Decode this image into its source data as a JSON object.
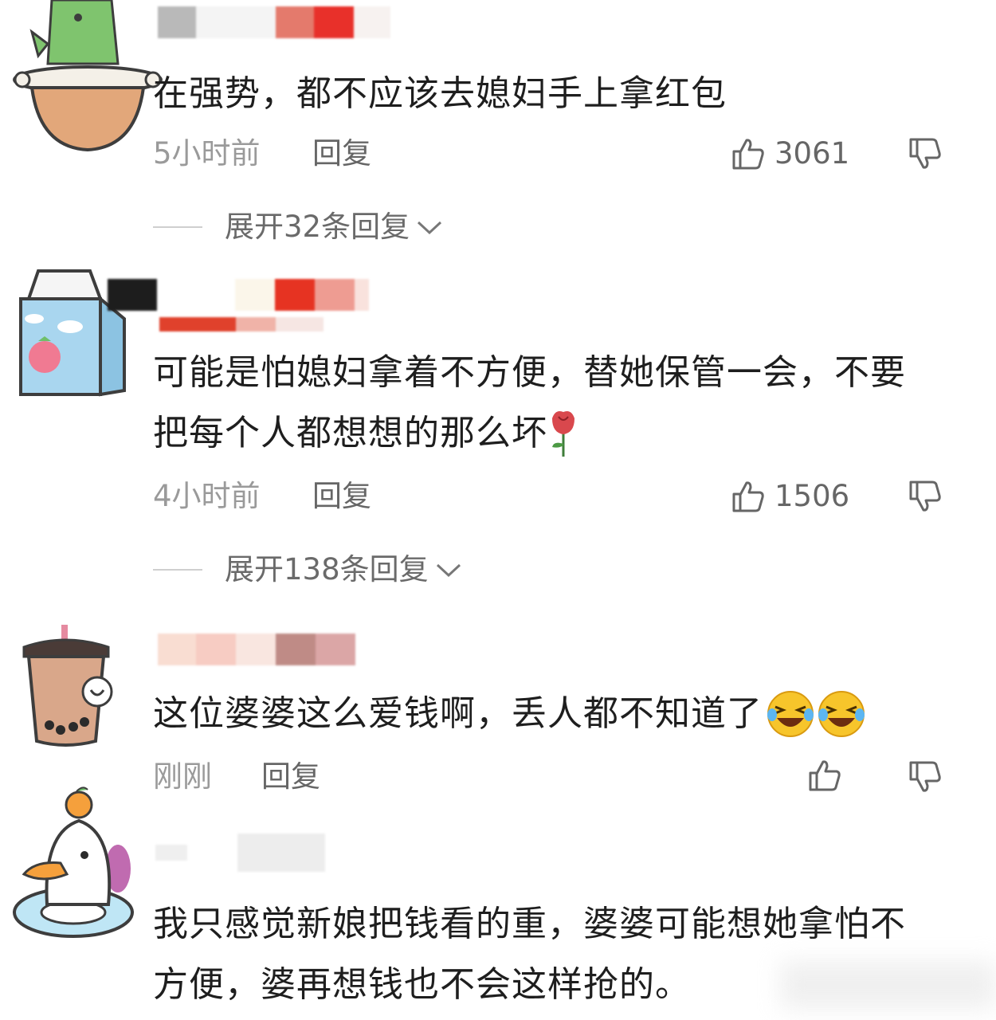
{
  "comments": [
    {
      "avatar": "dinosaur-in-pot-avatar",
      "lines": [
        "在强势，都不应该去媳妇手上拿红包"
      ],
      "time": "5小时前",
      "reply_label": "回复",
      "likes": "3061",
      "expand": "展开32条回复"
    },
    {
      "avatar": "milk-carton-avatar",
      "lines": [
        "可能是怕媳妇拿着不方便，替她保管一会，不要",
        "把每个人都想想的那么坏"
      ],
      "emoji": "rose-emoji",
      "time": "4小时前",
      "reply_label": "回复",
      "likes": "1506",
      "expand": "展开138条回复"
    },
    {
      "avatar": "bubble-tea-avatar",
      "lines": [
        "这位婆婆这么爱钱啊，丢人都不知道了"
      ],
      "emoji": "laughing-crying-emoji",
      "time": "刚刚",
      "reply_label": "回复"
    },
    {
      "avatar": "duck-with-orange-avatar",
      "lines": [
        "我只感觉新娘把钱看的重，婆婆可能想她拿怕不",
        "方便，婆再想钱也不会这样抢的。"
      ]
    }
  ],
  "colors": {
    "text": "#1e1e1e",
    "meta": "#9a9a9a",
    "icon": "#666666",
    "emoji_yellow": "#f7c52b",
    "rose": "#d9484d"
  }
}
